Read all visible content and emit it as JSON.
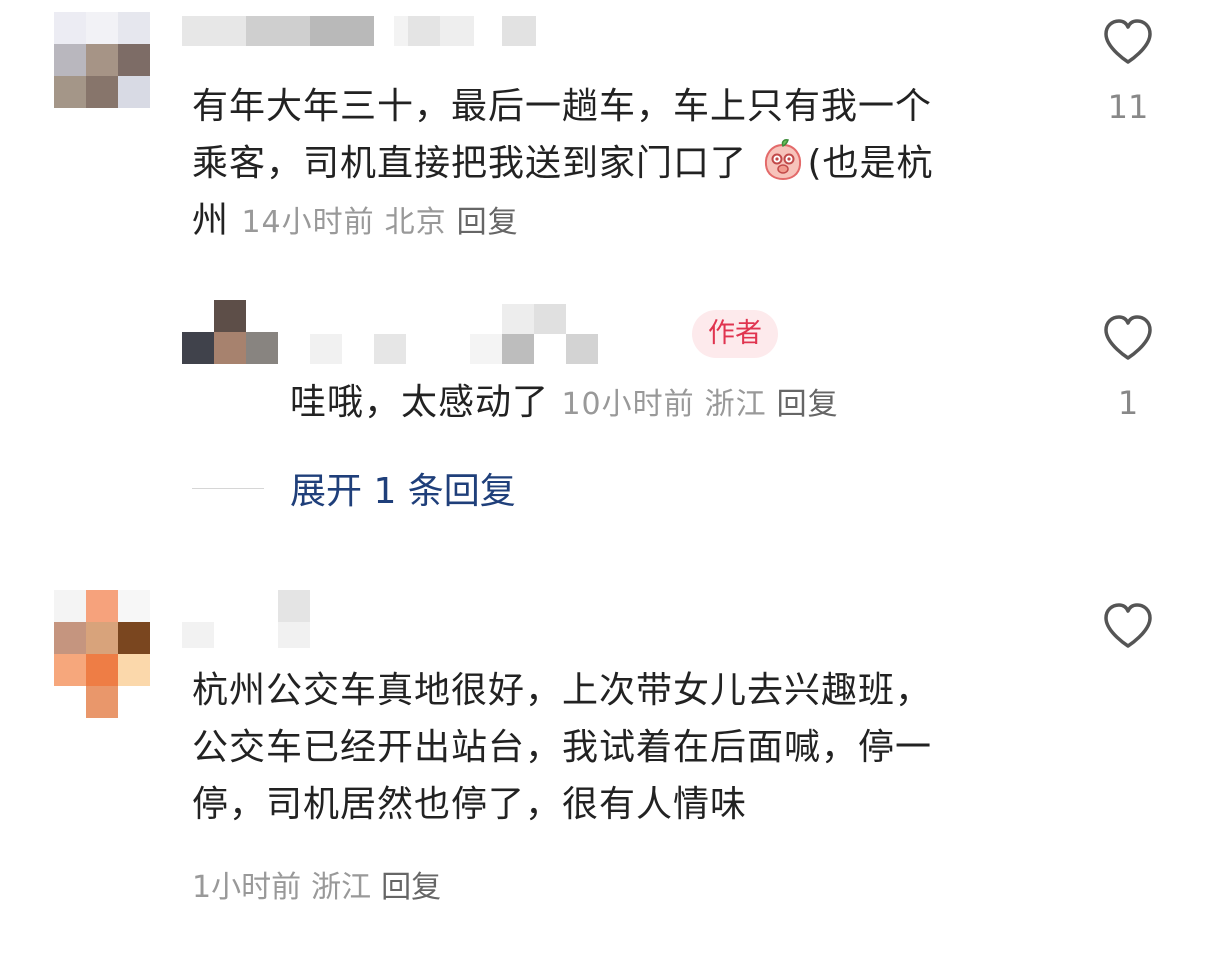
{
  "comments": [
    {
      "text_lines": [
        "有年大年三十，最后一趟车，车上只有我一个",
        "乘客，司机直接把我送到家门口了",
        "州"
      ],
      "emoji_after_line2": "peach-emoji-icon",
      "tail_line2": "(也是杭",
      "time": "14小时前",
      "location": "北京",
      "reply_label": "回复",
      "likes": "11",
      "reply": {
        "author_badge": "作者",
        "text": "哇哦，太感动了",
        "time": "10小时前",
        "location": "浙江",
        "reply_label": "回复",
        "likes": "1"
      },
      "expand_label": "展开 1 条回复"
    },
    {
      "text_lines": [
        "杭州公交车真地很好，上次带女儿去兴趣班，",
        "公交车已经开出站台，我试着在后面喊，停一",
        "停，司机居然也停了，很有人情味"
      ],
      "time": "1小时前",
      "location": "浙江",
      "reply_label": "回复",
      "likes": ""
    }
  ],
  "colors": {
    "text": "#222222",
    "meta": "#999999",
    "link": "#1f3f7a",
    "badge_bg": "#fdeaec",
    "badge_fg": "#e0344f"
  }
}
